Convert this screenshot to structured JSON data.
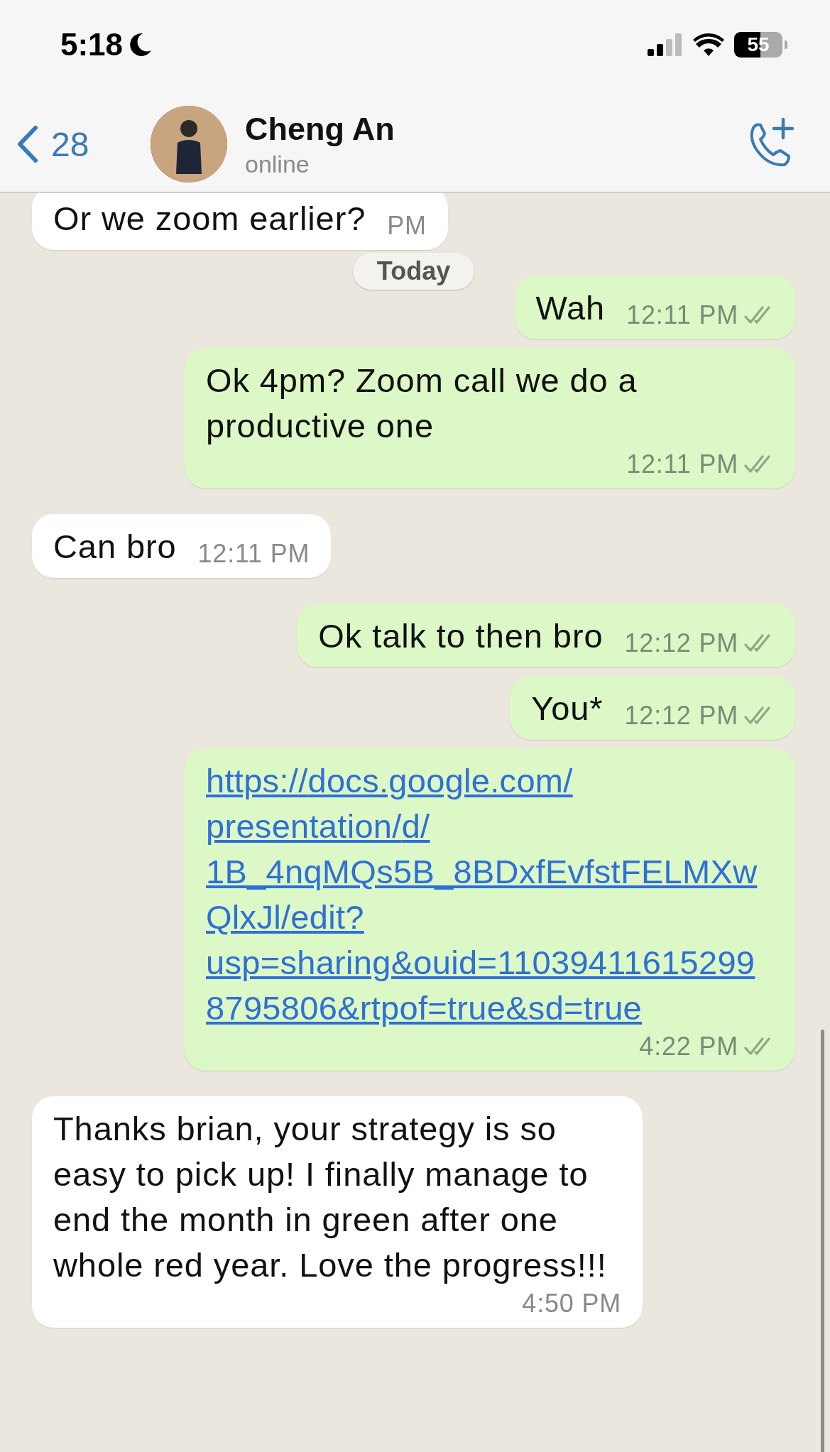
{
  "status_bar": {
    "time": "5:18",
    "battery": "55"
  },
  "header": {
    "back_count": "28",
    "contact_name": "Cheng An",
    "status": "online"
  },
  "date_chip": "Today",
  "messages": [
    {
      "kind": "text",
      "sent": false,
      "text": "Or we zoom earlier?",
      "time": "PM"
    },
    {
      "kind": "text",
      "sent": true,
      "text": "Wah",
      "time": "12:11 PM",
      "read": false
    },
    {
      "kind": "text",
      "sent": true,
      "text": "Ok 4pm? Zoom call we do a productive one",
      "time": "12:11 PM",
      "read": false
    },
    {
      "kind": "text",
      "sent": false,
      "text": "Can bro",
      "time": "12:11 PM"
    },
    {
      "kind": "text",
      "sent": true,
      "text": "Ok talk to then bro",
      "time": "12:12 PM",
      "read": false
    },
    {
      "kind": "text",
      "sent": true,
      "text": "You*",
      "time": "12:12 PM",
      "read": false
    },
    {
      "kind": "link",
      "sent": true,
      "text": "https://docs.google.com/presentation/d/1B_4nqMQs5B_8BDxfEvfstFELMXwQlxJl/edit?usp=sharing&ouid=110394116152998795806&rtpof=true&sd=true",
      "time": "4:22 PM",
      "read": false
    },
    {
      "kind": "text",
      "sent": false,
      "text": "Thanks brian, your strategy is so easy to pick up! I finally manage to end the month in green after one whole red year. Love the progress!!!",
      "time": "4:50 PM"
    }
  ]
}
